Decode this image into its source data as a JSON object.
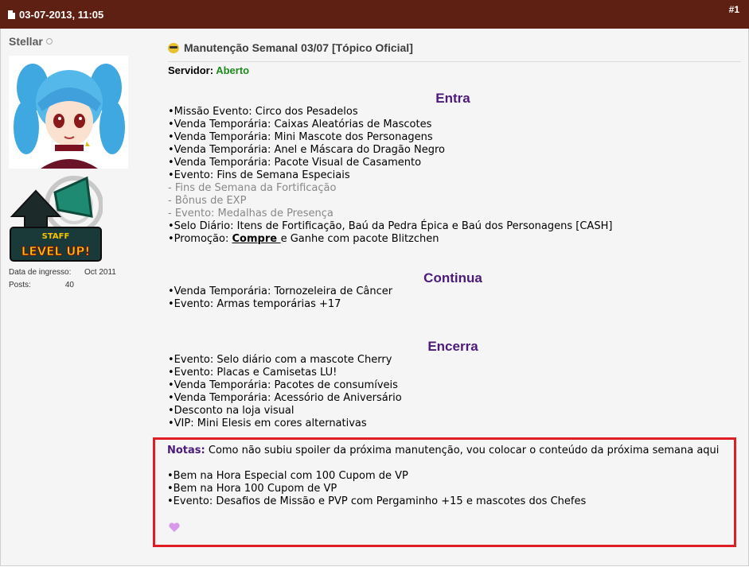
{
  "header": {
    "date": "03-07-2013, 11:05",
    "post_number": "#1",
    "background": "#5e2012"
  },
  "user": {
    "name": "Stellar",
    "join_label": "Data de ingresso:",
    "join_value": "Oct 2011",
    "posts_label": "Posts:",
    "posts_value": "40",
    "badge_top": "STAFF",
    "badge_bottom": "LEVEL UP!"
  },
  "post": {
    "title": "Manutenção Semanal 03/07 [Tópico Oficial]",
    "server_label": "Servidor:",
    "server_status": "Aberto",
    "sections": {
      "entra": {
        "heading": "Entra",
        "items": [
          "•Missão Evento: Circo dos Pesadelos",
          "•Venda Temporária: Caixas Aleatórias de Mascotes",
          "•Venda Temporária: Mini Mascote dos Personagens",
          "•Venda Temporária: Anel e Máscara do Dragão Negro",
          "•Venda Temporária: Pacote Visual de Casamento",
          "•Evento: Fins de Semana Especiais",
          "- Fins de Semana da Fortificação",
          "- Bônus de EXP",
          "- Evento: Medalhas de Presença",
          "•Selo Diário: Itens de Fortificação, Baú da Pedra Épica e Baú dos Personagens [CASH]"
        ],
        "promo_prefix": "•Promoção: ",
        "promo_link": "Compre ",
        "promo_suffix": "e Ganhe com pacote Blitzchen"
      },
      "continua": {
        "heading": "Continua",
        "items": [
          "•Venda Temporária: Tornozeleira de Câncer",
          "•Evento: Armas temporárias +17"
        ]
      },
      "encerra": {
        "heading": "Encerra",
        "items": [
          "•Evento: Selo diário com a mascote Cherry",
          "•Evento: Placas e Camisetas LU!",
          "•Venda Temporária: Pacotes de consumíveis",
          "•Venda Temporária: Acessório de Aniversário",
          "•Desconto na loja visual",
          "•VIP: Mini Elesis em cores alternativas"
        ]
      }
    },
    "notes": {
      "label": "Notas:",
      "text": " Como não subiu spoiler da próxima manutenção, vou colocar o conteúdo da próxima semana aqui",
      "items": [
        "•Bem na Hora Especial com 100 Cupom de VP",
        "•Bem na Hora 100 Cupom de VP",
        "•Evento: Desafios de Missão e PVP com Pergaminho +15 e mascotes dos Chefes"
      ]
    }
  },
  "colors": {
    "heading": "#4b1a7a",
    "status_open": "#1d8a1d",
    "highlight_border": "#e01c24"
  }
}
